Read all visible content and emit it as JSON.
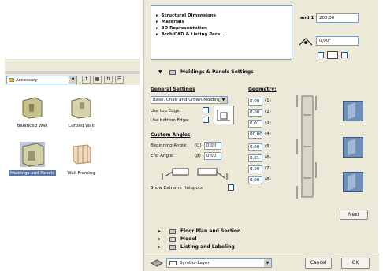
{
  "library": {
    "folder_name": "Accessory",
    "items": [
      {
        "label": "Balanced Wall"
      },
      {
        "label": "Curbed Wall"
      },
      {
        "label": "Moldings and Panels"
      },
      {
        "label": "Wall Framing"
      }
    ]
  },
  "tree": {
    "items": [
      "Structural Dimensions",
      "Materials",
      "3D Representation",
      "ArchiCAD & Listing Para..."
    ]
  },
  "top_values": {
    "height_label": "and 1",
    "height_value": "200,00",
    "offset_value": "0,00°"
  },
  "section": {
    "title": "Moldings & Panels Settings",
    "general_settings": "General Settings",
    "molding_type": "Base, Chair and Crown Molding",
    "use_top_edge": "Use top Edge:",
    "use_bottom_edge": "Use bottom Edge:",
    "custom_angles": "Custom Angles",
    "beginning_angle_label": "Beginning Angle:",
    "beginning_angle_idx": "(Ɑ)",
    "beginning_angle_value": "0,00",
    "end_angle_label": "End Angle:",
    "end_angle_idx": "(β)",
    "end_angle_value": "0,00",
    "show_ext_hotspots": "Show Extreme Hotspots",
    "geometry": "Geometry:",
    "geo_rows": [
      {
        "value": "0,00",
        "idx": "(1)"
      },
      {
        "value": "0,00",
        "idx": "(2)"
      },
      {
        "value": "0,01",
        "idx": "(3)"
      },
      {
        "value": "00,00",
        "idx": "(4)"
      },
      {
        "value": "0,00",
        "idx": "(5)"
      },
      {
        "value": "0,01",
        "idx": "(6)"
      },
      {
        "value": "0,00",
        "idx": "(7)"
      },
      {
        "value": "0,00",
        "idx": "(8)"
      }
    ],
    "next_button": "Next"
  },
  "collapsed_sections": [
    {
      "label": "Floor Plan and Section"
    },
    {
      "label": "Model"
    },
    {
      "label": "Listing and Labeling"
    }
  ],
  "bottom": {
    "layer": "Symbol-Layer",
    "cancel": "Cancel",
    "ok": "OK"
  }
}
